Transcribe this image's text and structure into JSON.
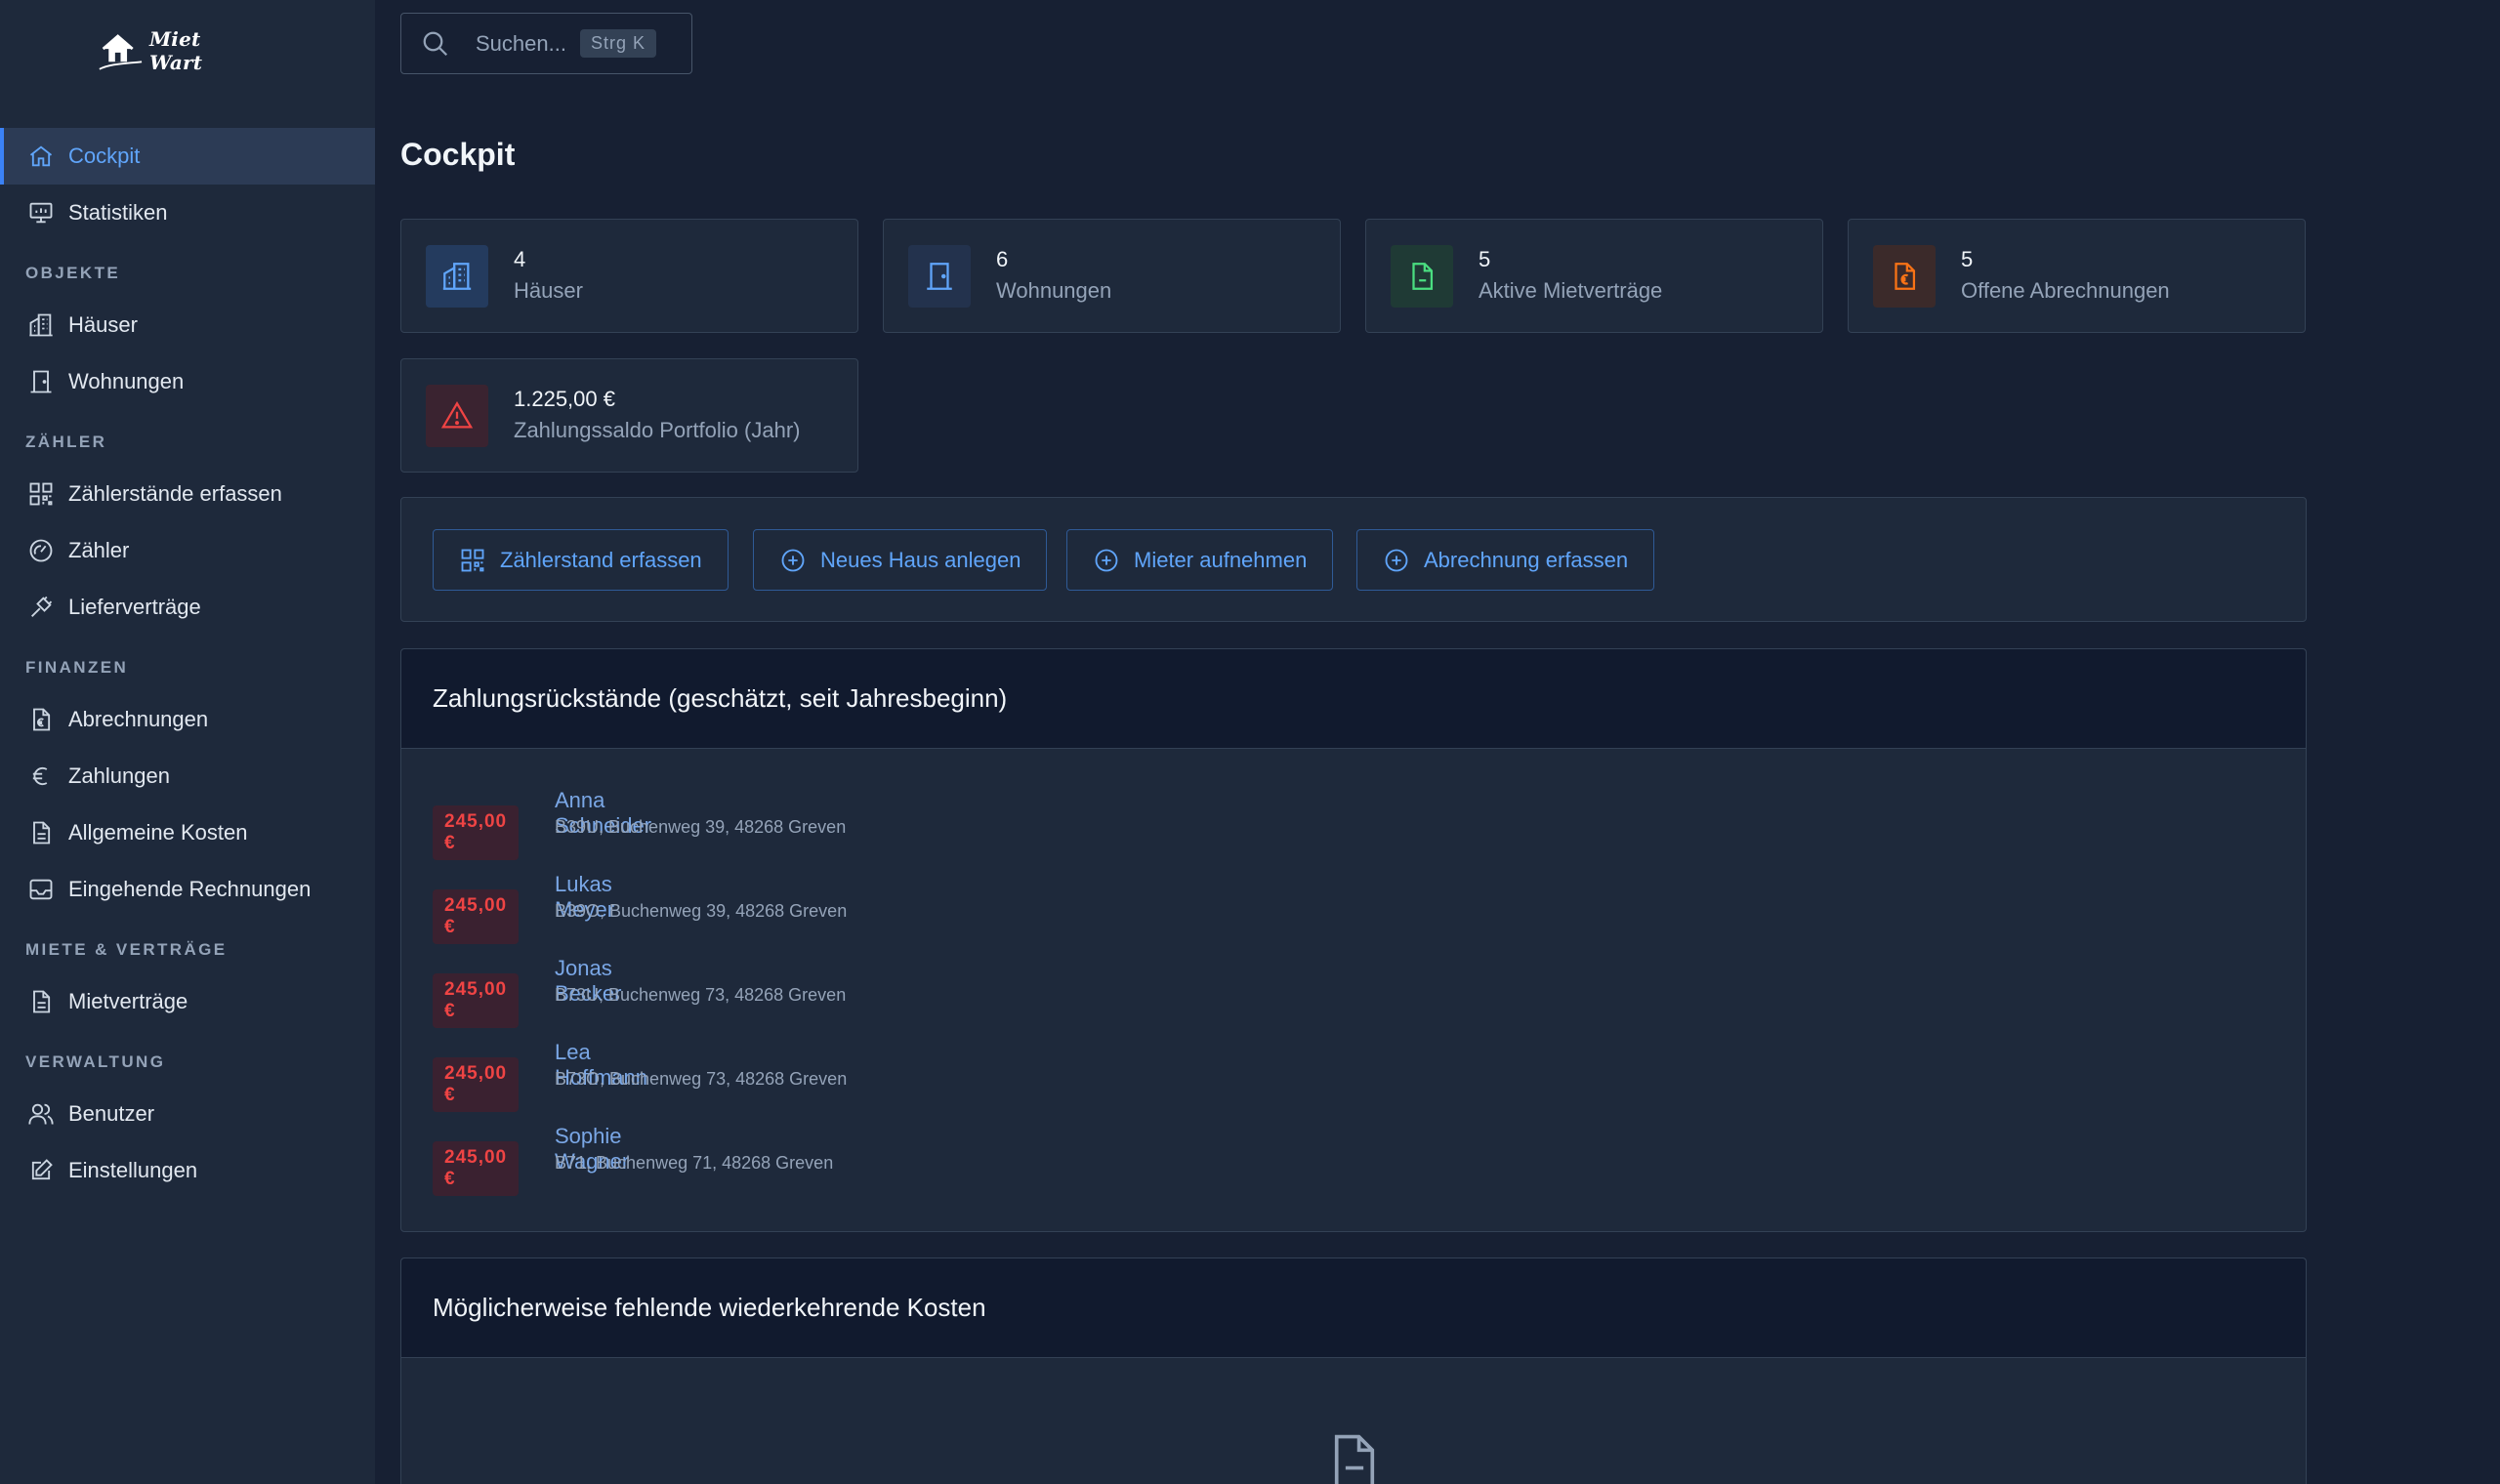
{
  "app": {
    "logo_text": "Miet Wart"
  },
  "sidebar": {
    "items_top": [
      {
        "label": "Cockpit",
        "icon": "home-icon"
      },
      {
        "label": "Statistiken",
        "icon": "presentation-chart-icon"
      }
    ],
    "sections": [
      {
        "title": "OBJEKTE",
        "items": [
          {
            "label": "Häuser",
            "icon": "building-icon"
          },
          {
            "label": "Wohnungen",
            "icon": "door-icon"
          }
        ]
      },
      {
        "title": "ZÄHLER",
        "items": [
          {
            "label": "Zählerstände erfassen",
            "icon": "qr-grid-icon"
          },
          {
            "label": "Zähler",
            "icon": "gauge-icon"
          },
          {
            "label": "Lieferverträge",
            "icon": "plug-icon"
          }
        ]
      },
      {
        "title": "FINANZEN",
        "items": [
          {
            "label": "Abrechnungen",
            "icon": "euro-document-icon"
          },
          {
            "label": "Zahlungen",
            "icon": "euro-icon"
          },
          {
            "label": "Allgemeine Kosten",
            "icon": "document-icon"
          },
          {
            "label": "Eingehende Rechnungen",
            "icon": "inbox-icon"
          }
        ]
      },
      {
        "title": "MIETE & VERTRÄGE",
        "items": [
          {
            "label": "Mietverträge",
            "icon": "document-icon"
          }
        ]
      },
      {
        "title": "VERWALTUNG",
        "items": [
          {
            "label": "Benutzer",
            "icon": "users-icon"
          },
          {
            "label": "Einstellungen",
            "icon": "edit-icon"
          }
        ]
      }
    ]
  },
  "search": {
    "placeholder": "Suchen...",
    "shortcut": "Strg K"
  },
  "page": {
    "title": "Cockpit"
  },
  "stats": [
    {
      "value": "4",
      "label": "Häuser",
      "icon": "building-icon",
      "color": "#60a5fa"
    },
    {
      "value": "6",
      "label": "Wohnungen",
      "icon": "door-icon",
      "color": "#60a5fa"
    },
    {
      "value": "5",
      "label": "Aktive Mietverträge",
      "icon": "document-icon",
      "color": "#4ade80"
    },
    {
      "value": "5",
      "label": "Offene Abrechnungen",
      "icon": "euro-document-icon",
      "color": "#f97316"
    },
    {
      "value": "1.225,00 €",
      "label": "Zahlungssaldo Portfolio (Jahr)",
      "icon": "warning-icon",
      "color": "#ef4444"
    }
  ],
  "quick_actions": [
    {
      "label": "Zählerstand erfassen",
      "icon": "qr-grid-icon"
    },
    {
      "label": "Neues Haus anlegen",
      "icon": "plus-circle-icon"
    },
    {
      "label": "Mieter aufnehmen",
      "icon": "plus-circle-icon"
    },
    {
      "label": "Abrechnung erfassen",
      "icon": "plus-circle-icon"
    }
  ],
  "arrears": {
    "title": "Zahlungsrückstände (geschätzt, seit Jahresbeginn)",
    "rows": [
      {
        "amount": "245,00 €",
        "name": "Anna Schneider",
        "address": "B39U, Buchenweg 39, 48268 Greven"
      },
      {
        "amount": "245,00 €",
        "name": "Lukas Meyer",
        "address": "B39O, Buchenweg 39, 48268 Greven"
      },
      {
        "amount": "245,00 €",
        "name": "Jonas Becker",
        "address": "B73U, Buchenweg 73, 48268 Greven"
      },
      {
        "amount": "245,00 €",
        "name": "Lea Hoffmann",
        "address": "B73O, Buchenweg 73, 48268 Greven"
      },
      {
        "amount": "245,00 €",
        "name": "Sophie Wagner",
        "address": "B71, Buchenweg 71, 48268 Greven"
      }
    ]
  },
  "missing_costs": {
    "title": "Möglicherweise fehlende wiederkehrende Kosten",
    "icon": "document-icon"
  }
}
